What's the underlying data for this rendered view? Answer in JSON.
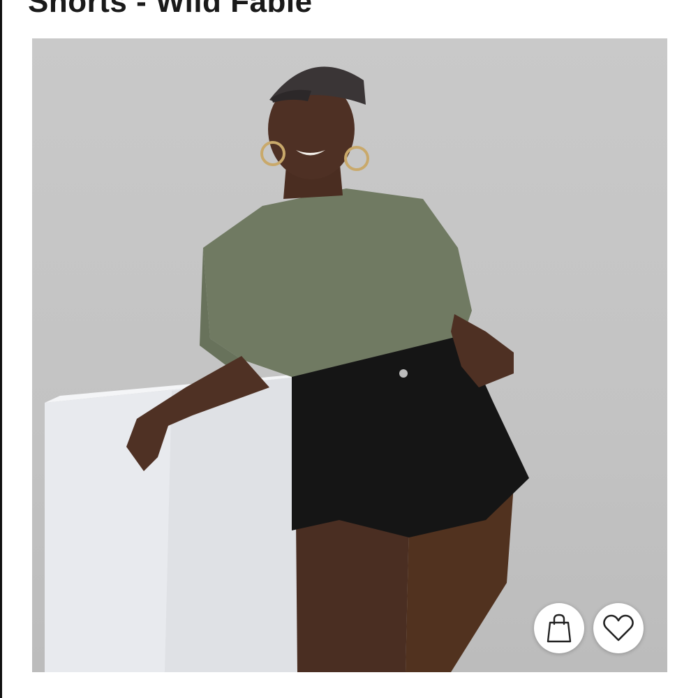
{
  "listing": {
    "title": "Shorts - Wild Fable"
  },
  "photo": {
    "subject": "product-photo"
  },
  "actions": {
    "bag_icon": "shopping-bag-icon",
    "like_icon": "heart-icon"
  }
}
